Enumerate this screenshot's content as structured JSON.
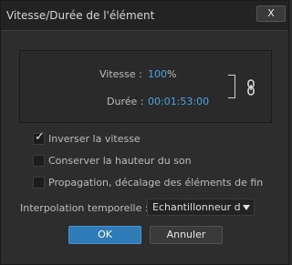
{
  "window": {
    "title": "Vitesse/Durée de l'élément",
    "close_label": "X"
  },
  "speed_panel": {
    "speed_label": "Vitesse :",
    "speed_value": "100",
    "speed_unit": "%",
    "duration_label": "Durée :",
    "duration_value": "00:01:53:00",
    "link_icon": "chain-link-icon"
  },
  "options": {
    "reverse_speed": {
      "label": "Inverser la vitesse",
      "checked": true
    },
    "keep_pitch": {
      "label": "Conserver la hauteur du son",
      "checked": false
    },
    "ripple_edit": {
      "label": "Propagation, décalage des éléments de fin",
      "checked": false
    }
  },
  "interpolation": {
    "label": "Interpolation temporelle :",
    "selected": "Echantillonneur d'image"
  },
  "buttons": {
    "ok": "OK",
    "cancel": "Annuler"
  },
  "colors": {
    "accent": "#2e7bb8",
    "value_blue": "#4aa6e0",
    "background": "#2d2d2d"
  }
}
